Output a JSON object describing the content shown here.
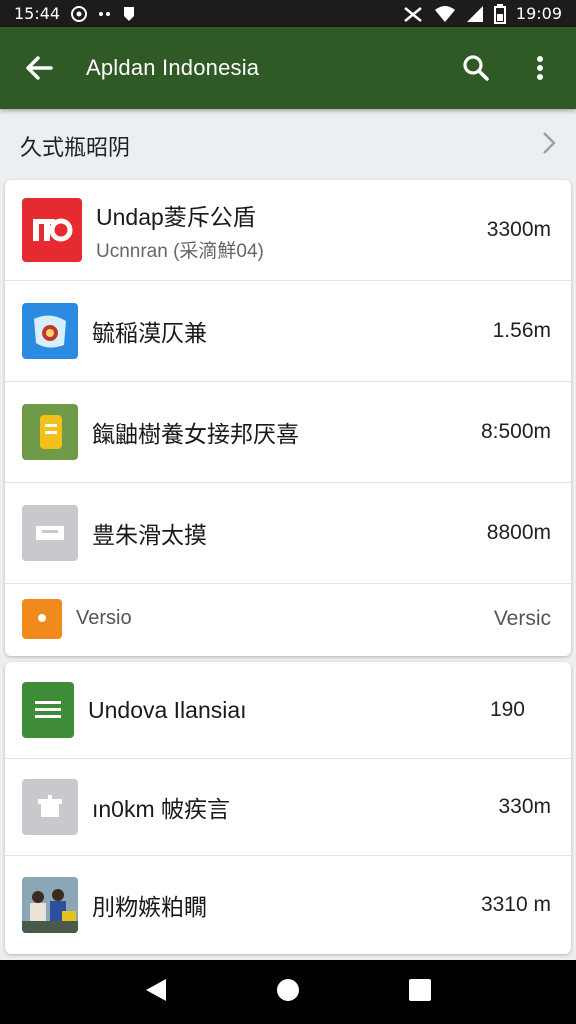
{
  "status_bar": {
    "time_left": "15:44",
    "time_right": "19:09",
    "icons": [
      "circle-notification-icon",
      "dots-icon",
      "shield-icon",
      "mute-icon",
      "wifi-icon",
      "signal-icon",
      "battery-icon"
    ]
  },
  "app_bar": {
    "title": "Apldan Indonesia",
    "back_icon": "arrow-back-icon",
    "search_icon": "search-icon",
    "menu_icon": "more-vert-icon",
    "color": "#2f5a25"
  },
  "section": {
    "title": "久式瓶昭阴"
  },
  "list1": [
    {
      "name": "Undap菱斥公盾",
      "sub": "Ucnnran (采滴鮮04)",
      "value": "3300m",
      "icon": "red-app-icon"
    },
    {
      "name": "毓稲漠仄兼",
      "sub": "",
      "value": "1.56m",
      "icon": "blue-app-icon"
    },
    {
      "name": "餼鼬樹養女接邦厌喜",
      "sub": "",
      "value": "8:500m",
      "icon": "yellow-app-icon"
    },
    {
      "name": "豊朱滑太摸",
      "sub": "",
      "value": "8800m",
      "icon": "grey-folder-icon"
    }
  ],
  "version_row": {
    "label": "Versio",
    "value": "Versic",
    "icon": "orange-chat-icon"
  },
  "list2": [
    {
      "name": "Undova Ilansiaı",
      "value": "190",
      "icon": "green-doc-icon"
    },
    {
      "name": "ın0km 帔疾言",
      "value": "330m",
      "icon": "grey-gift-icon"
    },
    {
      "name": "刖粅嫉粕瞯",
      "value": "3310 m",
      "icon": "photo-people-icon"
    }
  ],
  "nav_bar": {
    "back": "nav-back-icon",
    "home": "nav-home-icon",
    "recents": "nav-recents-icon"
  }
}
